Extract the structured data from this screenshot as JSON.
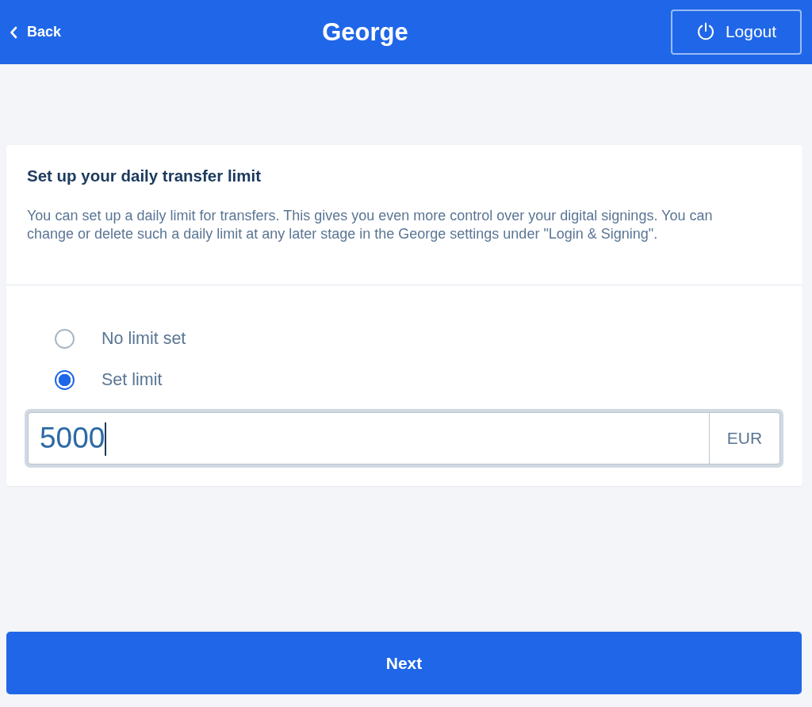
{
  "header": {
    "back": {
      "label": "Back"
    },
    "title": "George",
    "logout": {
      "label": "Logout"
    }
  },
  "card": {
    "title": "Set up your daily transfer limit",
    "description": "You can set up a daily limit for transfers. This gives you even more control over your digital signings. You can change or delete such a daily limit at any later stage in the George settings under \"Login & Signing\".",
    "options": [
      {
        "label": "No limit set",
        "selected": false
      },
      {
        "label": "Set limit",
        "selected": true
      }
    ],
    "amount": {
      "value": "5000",
      "currency": "EUR",
      "focused": true
    }
  },
  "next_button": {
    "label": "Next"
  }
}
